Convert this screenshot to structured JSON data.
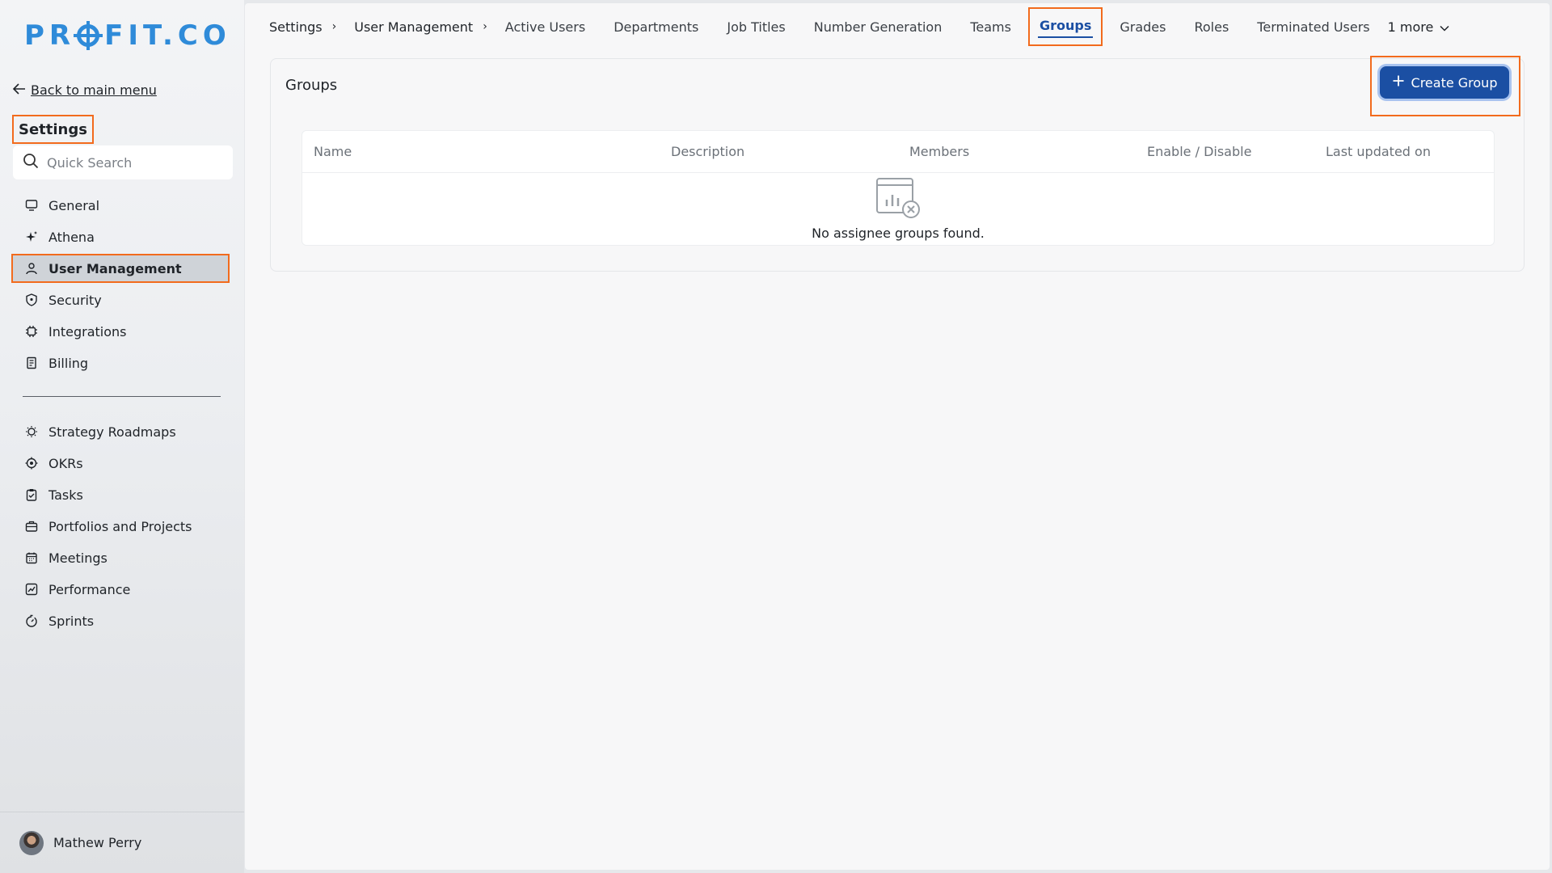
{
  "brand": {
    "logo_text": "PR FIT.CO",
    "logo_left": "PR",
    "logo_right": "FIT.CO",
    "color": "#2f8bd9"
  },
  "sidebar": {
    "back_label": "Back to main menu",
    "title": "Settings",
    "search": {
      "placeholder": "Quick Search",
      "value": ""
    },
    "items": [
      {
        "label": "General",
        "icon": "monitor-icon"
      },
      {
        "label": "Athena",
        "icon": "sparkle-icon"
      },
      {
        "label": "User Management",
        "icon": "user-icon",
        "active": true
      },
      {
        "label": "Security",
        "icon": "shield-icon"
      },
      {
        "label": "Integrations",
        "icon": "chip-icon"
      },
      {
        "label": "Billing",
        "icon": "receipt-icon"
      }
    ],
    "modules": [
      {
        "label": "Strategy Roadmaps",
        "icon": "bulb-icon"
      },
      {
        "label": "OKRs",
        "icon": "target-icon"
      },
      {
        "label": "Tasks",
        "icon": "clipboard-check-icon"
      },
      {
        "label": "Portfolios and Projects",
        "icon": "briefcase-icon"
      },
      {
        "label": "Meetings",
        "icon": "calendar-icon"
      },
      {
        "label": "Performance",
        "icon": "chart-line-icon"
      },
      {
        "label": "Sprints",
        "icon": "stopwatch-icon"
      }
    ],
    "user": {
      "name": "Mathew Perry"
    }
  },
  "topnav": {
    "breadcrumbs": [
      "Settings",
      "User Management"
    ],
    "separator": "›",
    "tabs": [
      "Active Users",
      "Departments",
      "Job Titles",
      "Number Generation",
      "Teams",
      "Groups",
      "Grades",
      "Roles",
      "Terminated Users"
    ],
    "active_tab": "Groups",
    "more_label": "1 more"
  },
  "groups": {
    "title": "Groups",
    "create_label": "Create Group",
    "columns": [
      "Name",
      "Description",
      "Members",
      "Enable / Disable",
      "Last updated on"
    ],
    "empty_text": "No assignee groups found."
  },
  "colors": {
    "accent": "#1b4fa3",
    "highlight": "#f26b1d"
  }
}
